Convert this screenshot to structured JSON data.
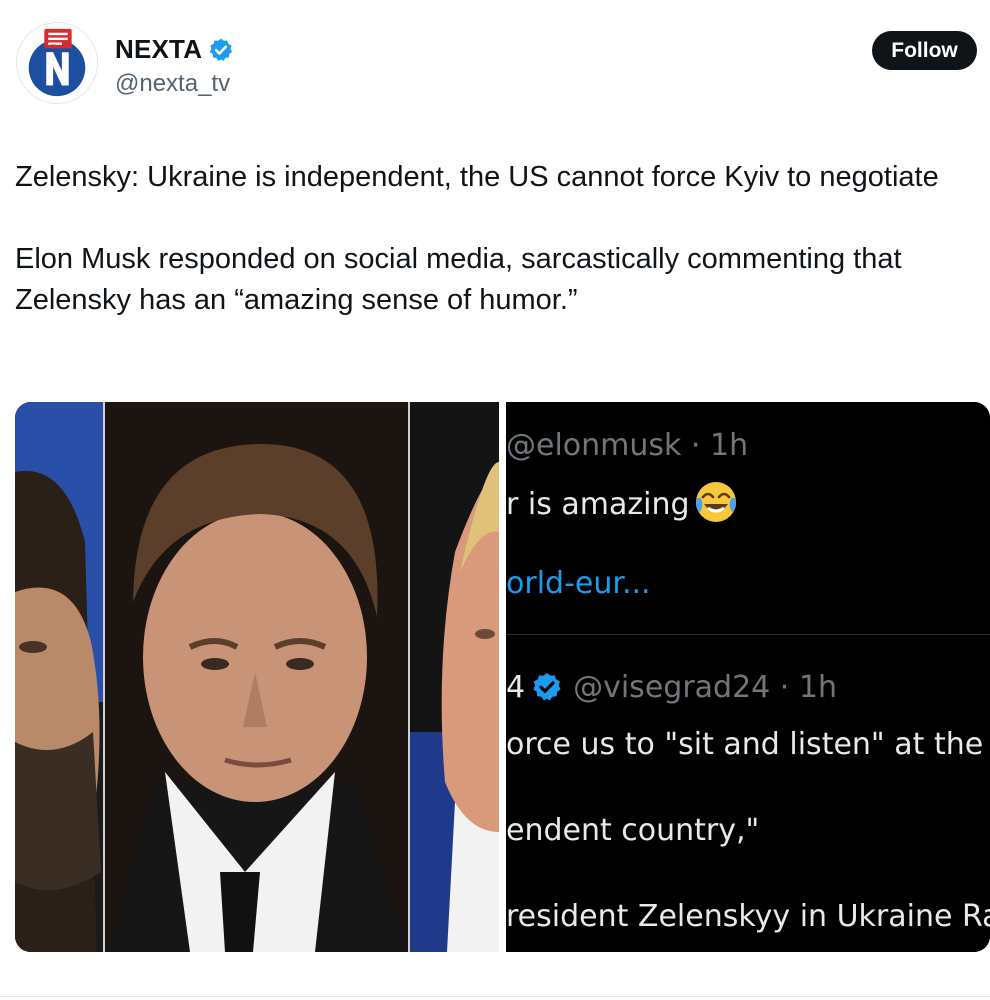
{
  "author": {
    "display_name": "NEXTA",
    "handle": "@nexta_tv",
    "avatar_icon": "nexta-logo-icon",
    "verified_icon": "verified-badge-icon"
  },
  "follow_label": "Follow",
  "post": {
    "paragraphs": [
      "Zelensky: Ukraine is independent, the US cannot force Kyiv to negotiate",
      "Elon Musk responded on social media, sarcastically commenting that Zelensky has an “amazing sense of humor.”"
    ]
  },
  "media": {
    "screenshot": {
      "first_meta": "@elonmusk · 1h",
      "first_text": "r is amazing",
      "first_emoji": "laughing-crying-emoji-icon",
      "first_link": "orld-eur...",
      "second_prefix": "4",
      "second_meta": "@visegrad24 · 1h",
      "second_line1": "orce us to \"sit and listen\" at the r",
      "second_line2": "endent country,\"",
      "second_line3": "resident Zelenskyy in Ukraine Ra"
    }
  },
  "colors": {
    "verified_blue": "#1d9bf0",
    "follow_bg": "#0f1419",
    "handle_gray": "#536471"
  }
}
